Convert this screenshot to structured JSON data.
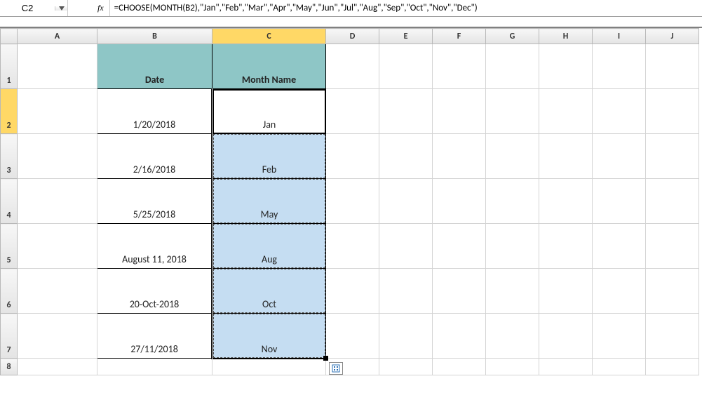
{
  "formula_bar": {
    "cell_ref": "C2",
    "fx_label": "fx",
    "formula": "=CHOOSE(MONTH(B2),\"Jan\",\"Feb\",\"Mar\",\"Apr\",\"May\",\"Jun\",\"Jul\",\"Aug\",\"Sep\",\"Oct\",\"Nov\",\"Dec\")"
  },
  "columns": [
    "A",
    "B",
    "C",
    "D",
    "E",
    "F",
    "G",
    "H",
    "I",
    "J"
  ],
  "selected_column": "C",
  "rows": [
    1,
    2,
    3,
    4,
    5,
    6,
    7,
    8
  ],
  "selected_row": 2,
  "headers": {
    "date": "Date",
    "month": "Month Name"
  },
  "data": [
    {
      "date": "1/20/2018",
      "month": "Jan"
    },
    {
      "date": "2/16/2018",
      "month": "Feb"
    },
    {
      "date": "5/25/2018",
      "month": "May"
    },
    {
      "date": "August 11, 2018",
      "month": "Aug"
    },
    {
      "date": "20-Oct-2018",
      "month": "Oct"
    },
    {
      "date": "27/11/2018",
      "month": "Nov"
    }
  ],
  "col_widths": {
    "row_header": 24,
    "A": 114,
    "B": 164,
    "C": 162,
    "other": 76
  }
}
